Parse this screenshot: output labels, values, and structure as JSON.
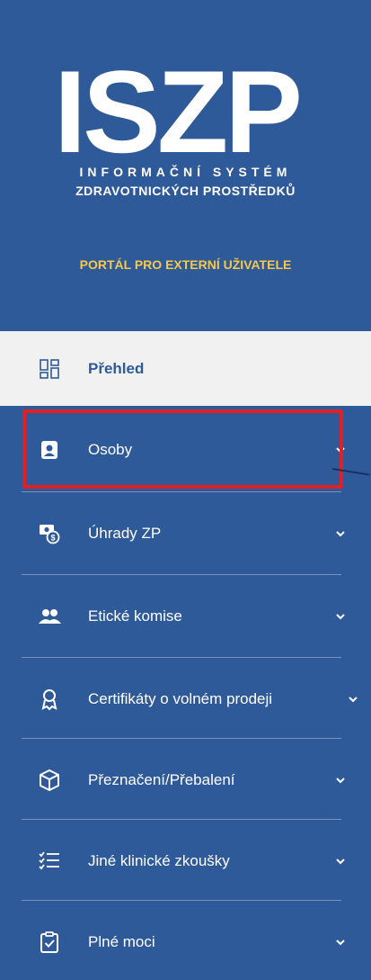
{
  "header": {
    "logo_text": "ISZP",
    "subtitle_line1": "INFORMAČNÍ SYSTÉM",
    "subtitle_line2": "ZDRAVOTNICKÝCH PROSTŘEDKŮ",
    "portal_label": "PORTÁL PRO EXTERNÍ UŽIVATELE"
  },
  "nav": {
    "items": [
      {
        "label": "Přehled",
        "icon": "dashboard-icon",
        "active": true
      },
      {
        "label": "Osoby",
        "icon": "person-card-icon",
        "highlighted": true
      },
      {
        "label": "Úhrady ZP",
        "icon": "money-refund-icon"
      },
      {
        "label": "Etické komise",
        "icon": "users-icon"
      },
      {
        "label": "Certifikáty o volném prodeji",
        "icon": "award-icon"
      },
      {
        "label": "Přeznačení/Přebalení",
        "icon": "box-icon"
      },
      {
        "label": "Jiné klinické zkoušky",
        "icon": "checklist-icon"
      },
      {
        "label": "Plné moci",
        "icon": "clipboard-check-icon"
      }
    ]
  },
  "colors": {
    "sidebar_bg": "#2f5a99",
    "active_bg": "#f1f1f1",
    "accent_yellow": "#f5c84a",
    "highlight_red": "#e02025"
  }
}
